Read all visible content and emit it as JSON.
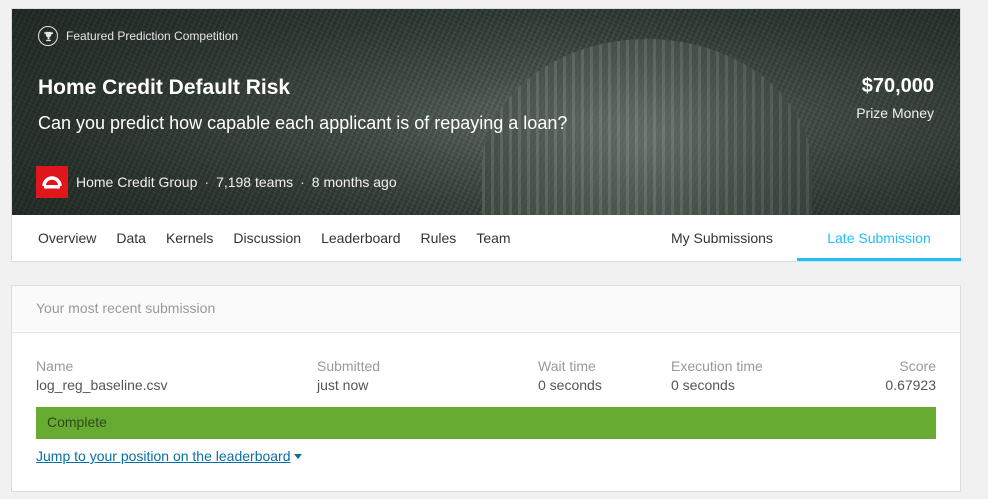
{
  "competition": {
    "badge": "Featured Prediction Competition",
    "title": "Home Credit Default Risk",
    "subtitle": "Can you predict how capable each applicant is of repaying a loan?",
    "prize_amount": "$70,000",
    "prize_label": "Prize Money",
    "host": "Home Credit Group",
    "teams": "7,198 teams",
    "age": "8 months ago",
    "separator": "·"
  },
  "tabs": {
    "items": [
      "Overview",
      "Data",
      "Kernels",
      "Discussion",
      "Leaderboard",
      "Rules",
      "Team"
    ],
    "my_submissions": "My Submissions",
    "late_submission": "Late Submission",
    "active": "Late Submission",
    "accent_color": "#20beff"
  },
  "submission": {
    "header": "Your most recent submission",
    "columns": {
      "name": {
        "label": "Name",
        "value": "log_reg_baseline.csv"
      },
      "submitted": {
        "label": "Submitted",
        "value": "just now"
      },
      "wait": {
        "label": "Wait time",
        "value": "0 seconds"
      },
      "execution": {
        "label": "Execution time",
        "value": "0 seconds"
      },
      "score": {
        "label": "Score",
        "value": "0.67923"
      }
    },
    "status": "Complete",
    "status_color": "#67ab32",
    "jump_link": "Jump to your position on the leaderboard"
  },
  "icons": {
    "featured": "trophy-icon",
    "host": "home-credit-logo",
    "jump": "caret-down-icon"
  }
}
